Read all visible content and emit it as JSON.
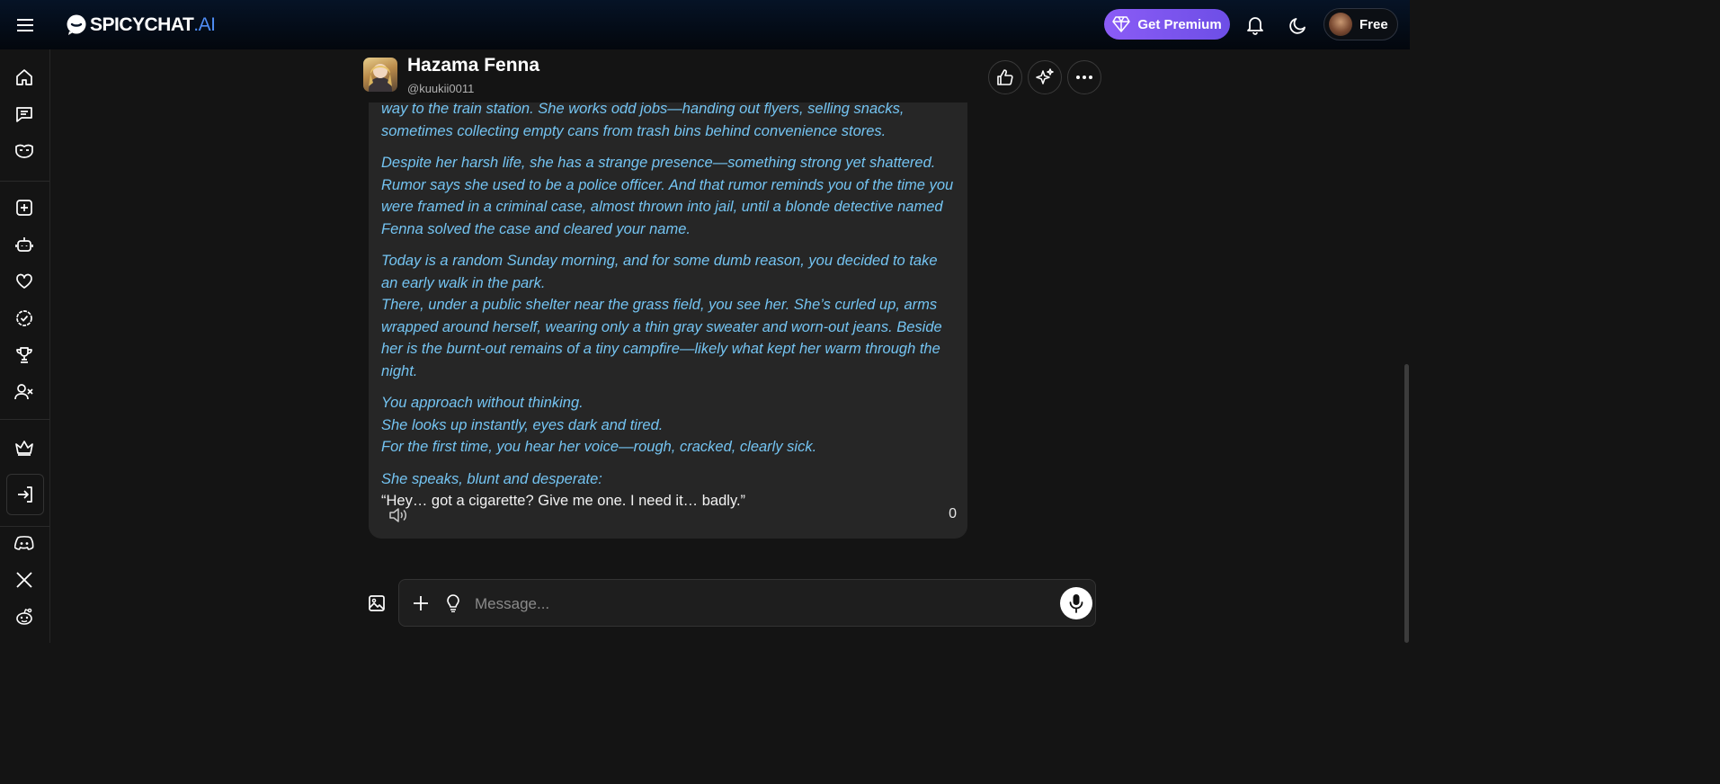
{
  "header": {
    "logo_main": "SPICYCHAT",
    "logo_tld": ".AI",
    "premium_label": "Get Premium",
    "plan_label": "Free"
  },
  "sidebar": {
    "items": [
      {
        "name": "home-icon"
      },
      {
        "name": "chats-icon"
      },
      {
        "name": "mask-icon"
      },
      {
        "name": "create-icon"
      },
      {
        "name": "bot-icon"
      },
      {
        "name": "heart-icon"
      },
      {
        "name": "badge-check-icon"
      },
      {
        "name": "trophy-icon"
      },
      {
        "name": "user-block-icon"
      },
      {
        "name": "crown-icon"
      },
      {
        "name": "login-icon"
      },
      {
        "name": "discord-icon"
      },
      {
        "name": "x-icon"
      },
      {
        "name": "reddit-icon"
      }
    ]
  },
  "chat": {
    "bot_name": "Hazama Fenna",
    "bot_handle": "@kuukii0011"
  },
  "message": {
    "p1": "way to the train station. She works odd jobs—handing out flyers, selling snacks, sometimes collecting empty cans from trash bins behind convenience stores.",
    "p2": "Despite her harsh life, she has a strange presence—something strong yet shattered. Rumor says she used to be a police officer. And that rumor reminds you of the time you were framed in a criminal case, almost thrown into jail, until a blonde detective named Fenna solved the case and cleared your name.",
    "p3a": "Today is a random Sunday morning, and for some dumb reason, you decided to take an early walk in the park.",
    "p3b": "There, under a public shelter near the grass field, you see her. She’s curled up, arms wrapped around herself, wearing only a thin gray sweater and worn-out jeans. Beside her is the burnt-out remains of a tiny campfire—likely what kept her warm through the night.",
    "p4a": "You approach without thinking.",
    "p4b": "She looks up instantly, eyes dark and tired.",
    "p4c": "For the first time, you hear her voice—rough, cracked, clearly sick.",
    "p5a": "She speaks, blunt and desperate:",
    "p5b": "“Hey… got a cigarette? Give me one. I need it… badly.”",
    "count": "0"
  },
  "composer": {
    "placeholder": "Message..."
  },
  "colors": {
    "accent_purple": "#8b5cf6",
    "italic_text": "#74c4f2",
    "logo_tld": "#4f8df5"
  }
}
